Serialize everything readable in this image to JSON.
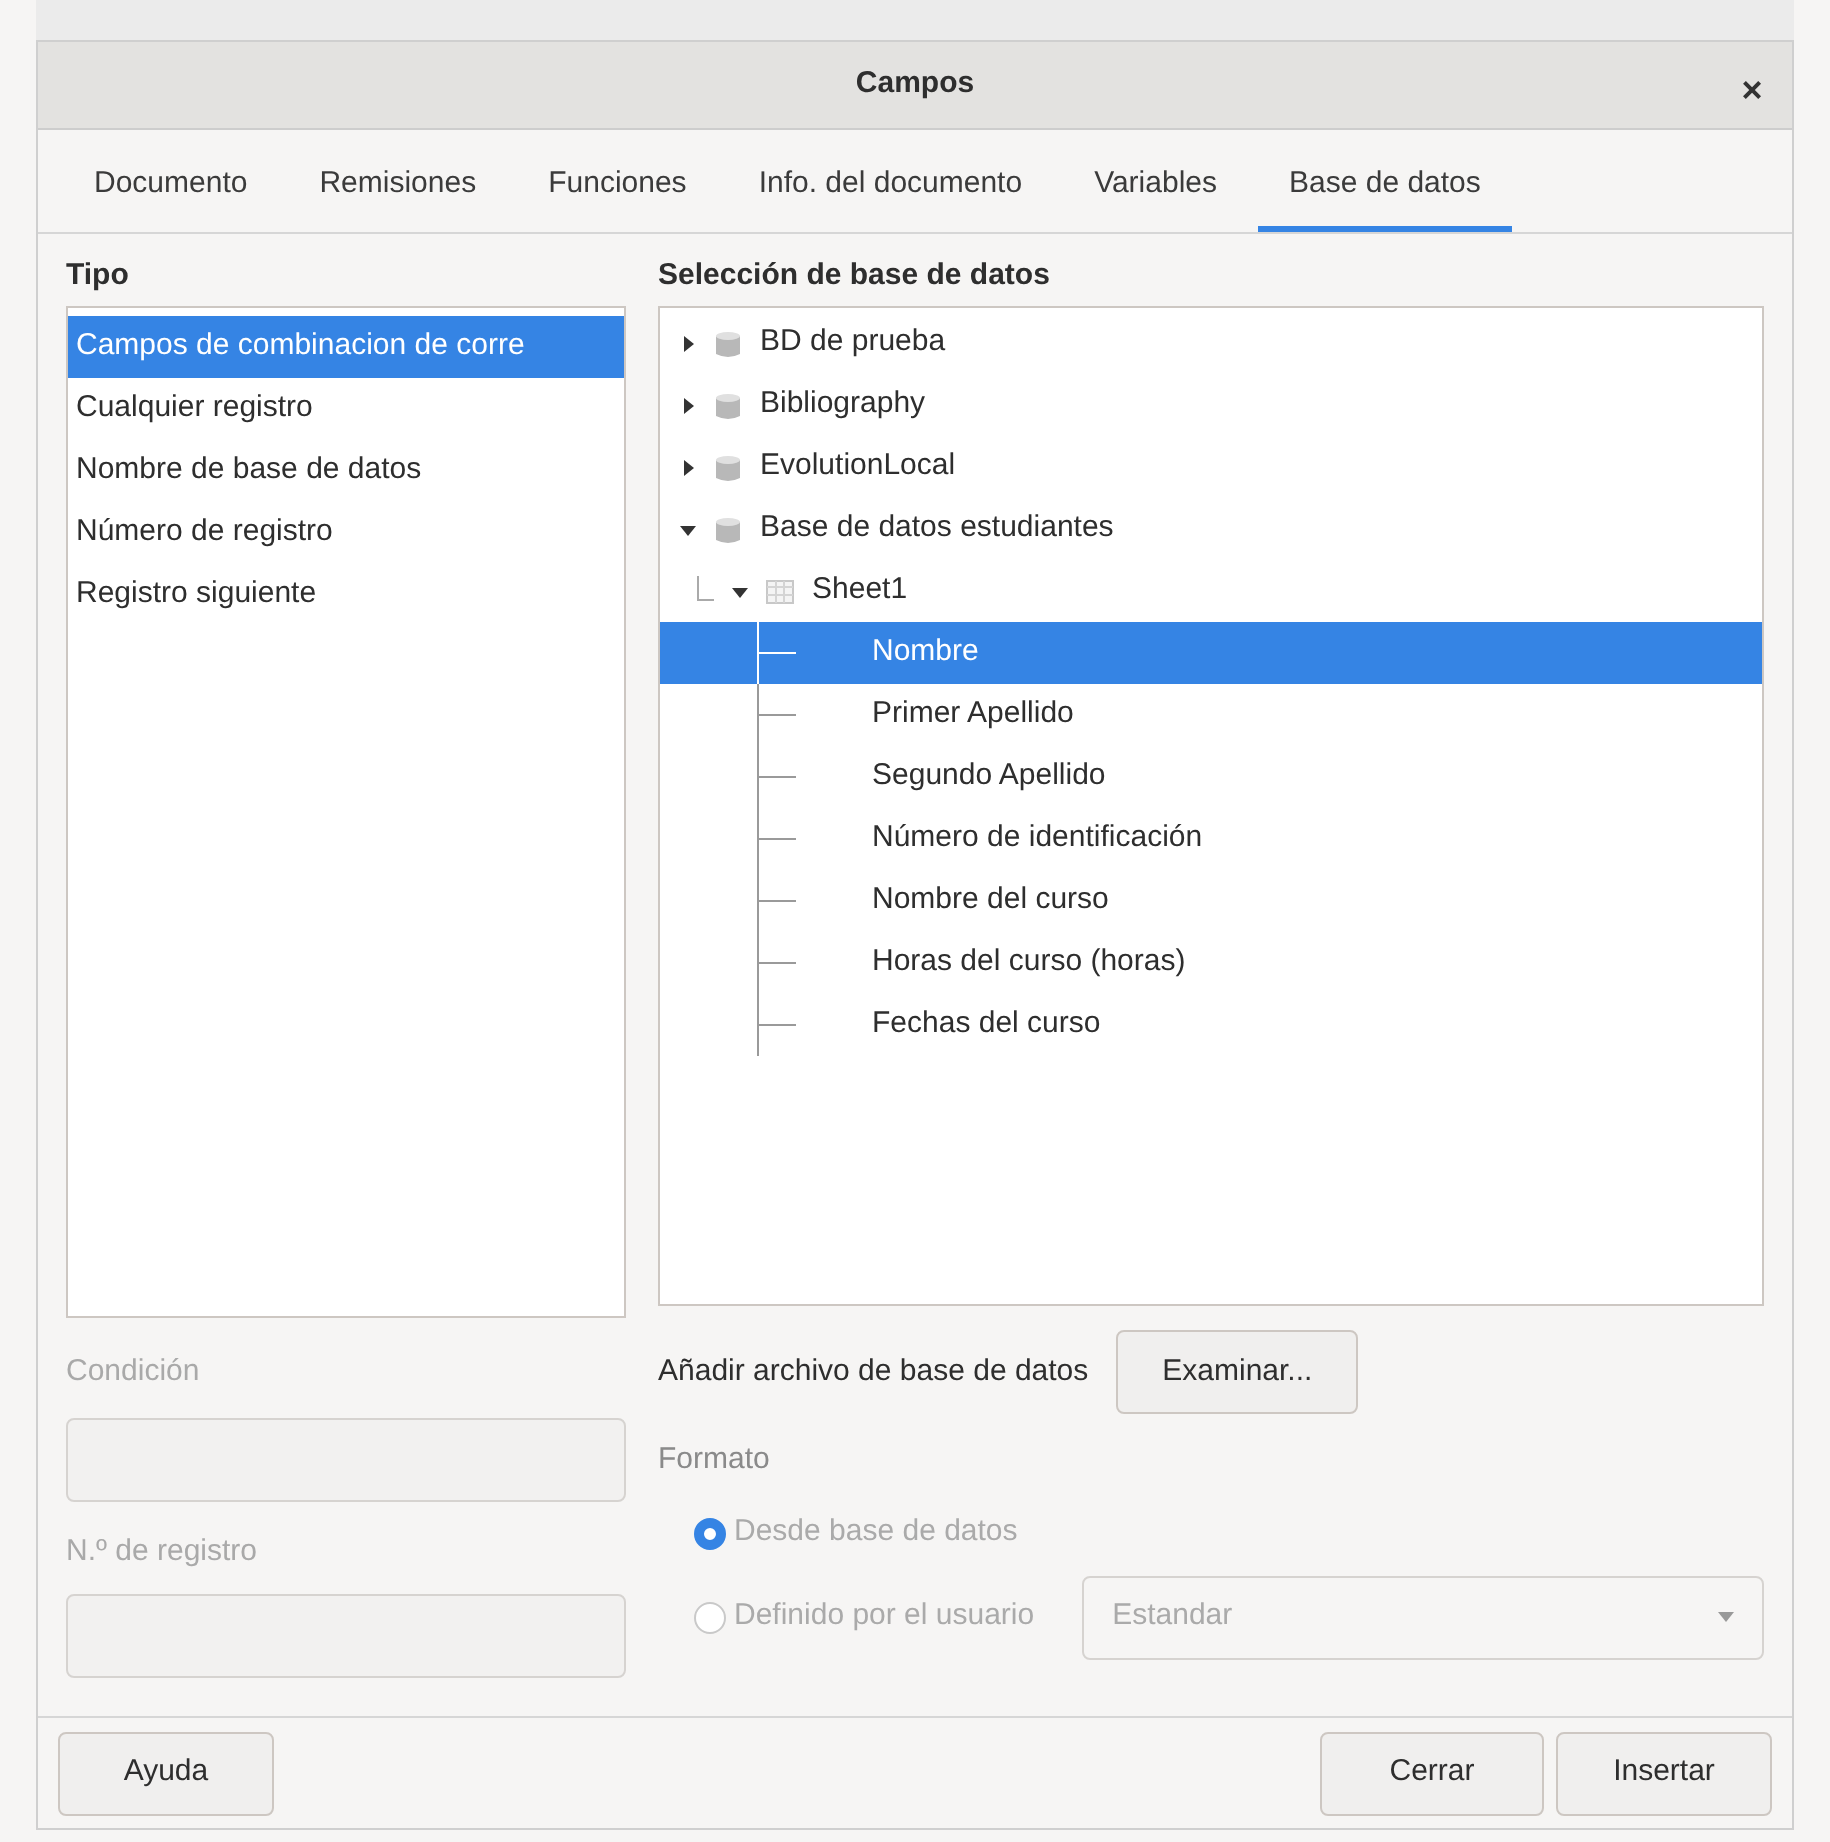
{
  "window": {
    "title": "Campos",
    "close": "×"
  },
  "tabs": [
    {
      "label": "Documento",
      "selected": false
    },
    {
      "label": "Remisiones",
      "selected": false
    },
    {
      "label": "Funciones",
      "selected": false
    },
    {
      "label": "Info. del documento",
      "selected": false
    },
    {
      "label": "Variables",
      "selected": false
    },
    {
      "label": "Base de datos",
      "selected": true
    }
  ],
  "type_list": {
    "heading": "Tipo",
    "items": [
      {
        "label": "Campos de combinacion de corre",
        "selected": true
      },
      {
        "label": "Cualquier registro",
        "selected": false
      },
      {
        "label": "Nombre de base de datos",
        "selected": false
      },
      {
        "label": "Número de registro",
        "selected": false
      },
      {
        "label": "Registro siguiente",
        "selected": false
      }
    ]
  },
  "condition": {
    "label": "Condición",
    "disabled": true
  },
  "record_number": {
    "label": "N.º de registro",
    "disabled": true
  },
  "database_tree": {
    "heading": "Selección de base de datos",
    "items": [
      {
        "label": "BD de prueba",
        "kind": "database",
        "expanded": false,
        "selected": false
      },
      {
        "label": "Bibliography",
        "kind": "database",
        "expanded": false,
        "selected": false
      },
      {
        "label": "EvolutionLocal",
        "kind": "database",
        "expanded": false,
        "selected": false
      },
      {
        "label": "Base de datos estudiantes",
        "kind": "database",
        "expanded": true,
        "selected": false,
        "children": [
          {
            "label": "Sheet1",
            "kind": "table",
            "expanded": true,
            "selected": false,
            "children": [
              {
                "label": "Nombre",
                "kind": "field",
                "selected": true
              },
              {
                "label": "Primer Apellido",
                "kind": "field",
                "selected": false
              },
              {
                "label": "Segundo Apellido",
                "kind": "field",
                "selected": false
              },
              {
                "label": "Número de identificación",
                "kind": "field",
                "selected": false
              },
              {
                "label": "Nombre del curso",
                "kind": "field",
                "selected": false
              },
              {
                "label": "Horas del curso (horas)",
                "kind": "field",
                "selected": false
              },
              {
                "label": "Fechas del curso",
                "kind": "field",
                "selected": false
              }
            ]
          }
        ]
      }
    ]
  },
  "add_file": {
    "label": "Añadir archivo de base de datos",
    "button": "Examinar..."
  },
  "format": {
    "heading": "Formato",
    "disabled": true,
    "options": [
      {
        "label": "Desde base de datos",
        "selected": true
      },
      {
        "label": "Definido por el usuario",
        "selected": false
      }
    ],
    "dropdown": "Estandar"
  },
  "buttons": {
    "help": "Ayuda",
    "close": "Cerrar",
    "insert": "Insertar"
  }
}
